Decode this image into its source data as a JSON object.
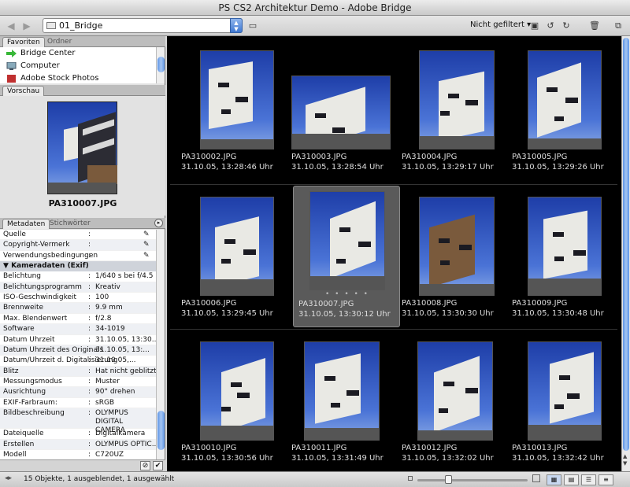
{
  "window": {
    "title": "PS CS2 Architektur Demo - Adobe Bridge"
  },
  "toolbar": {
    "path": "01_Bridge",
    "filter": "Nicht gefiltert"
  },
  "left_tabs_top": [
    "Favoriten",
    "Ordner"
  ],
  "favorites": [
    "Bridge Center",
    "Computer",
    "Adobe Stock Photos"
  ],
  "preview": {
    "tab": "Vorschau",
    "filename": "PA310007.JPG"
  },
  "meta_tabs": [
    "Metadaten",
    "Stichwörter"
  ],
  "metadata": {
    "iptc": [
      {
        "k": "Quelle",
        "v": ""
      },
      {
        "k": "Copyright-Vermerk",
        "v": ""
      },
      {
        "k": "Verwendungsbedingungen",
        "v": ""
      }
    ],
    "section": "Kameradaten (Exif)",
    "exif": [
      {
        "k": "Belichtung",
        "v": "1/640 s bei f/4.5"
      },
      {
        "k": "Belichtungsprogramm",
        "v": "Kreativ"
      },
      {
        "k": "ISO-Geschwindigkeit",
        "v": "100"
      },
      {
        "k": "Brennweite",
        "v": "9.9 mm"
      },
      {
        "k": "Max. Blendenwert",
        "v": "f/2.8"
      },
      {
        "k": "Software",
        "v": "34-1019"
      },
      {
        "k": "Datum Uhrzeit",
        "v": "31.10.05, 13:30..."
      },
      {
        "k": "Datum Uhrzeit des Originals",
        "v": "31.10.05, 13:..."
      },
      {
        "k": "Datum/Uhrzeit d. Digitalisierung",
        "v": "31.10.05,..."
      },
      {
        "k": "Blitz",
        "v": "Hat nicht geblitzt"
      },
      {
        "k": "Messungsmodus",
        "v": "Muster"
      },
      {
        "k": "Ausrichtung",
        "v": "90° drehen"
      },
      {
        "k": "EXIF-Farbraum:",
        "v": "sRGB"
      },
      {
        "k": "Bildbeschreibung",
        "v": "OLYMPUS DIGITAL CAMERA"
      },
      {
        "k": "Dateiquelle",
        "v": "Digitalkamera"
      },
      {
        "k": "Erstellen",
        "v": "OLYMPUS OPTIC..."
      },
      {
        "k": "Modell",
        "v": "C720UZ"
      }
    ]
  },
  "thumbnails": [
    {
      "name": "PA310002.JPG",
      "date": "31.10.05, 13:28:46 Uhr"
    },
    {
      "name": "PA310003.JPG",
      "date": "31.10.05, 13:28:54 Uhr"
    },
    {
      "name": "PA310004.JPG",
      "date": "31.10.05, 13:29:17 Uhr"
    },
    {
      "name": "PA310005.JPG",
      "date": "31.10.05, 13:29:26 Uhr"
    },
    {
      "name": "PA310006.JPG",
      "date": "31.10.05, 13:29:45 Uhr"
    },
    {
      "name": "PA310007.JPG",
      "date": "31.10.05, 13:30:12 Uhr"
    },
    {
      "name": "PA310008.JPG",
      "date": "31.10.05, 13:30:30 Uhr"
    },
    {
      "name": "PA310009.JPG",
      "date": "31.10.05, 13:30:48 Uhr"
    },
    {
      "name": "PA310010.JPG",
      "date": "31.10.05, 13:30:56 Uhr"
    },
    {
      "name": "PA310011.JPG",
      "date": "31.10.05, 13:31:49 Uhr"
    },
    {
      "name": "PA310012.JPG",
      "date": "31.10.05, 13:32:02 Uhr"
    },
    {
      "name": "PA310013.JPG",
      "date": "31.10.05, 13:32:42 Uhr"
    }
  ],
  "selected_index": 5,
  "status": {
    "text": "15 Objekte, 1 ausgeblendet, 1 ausgewählt"
  },
  "colors": {
    "selection": "#5a5a5a",
    "content_bg": "#000000",
    "accent": "#3f78d2"
  }
}
